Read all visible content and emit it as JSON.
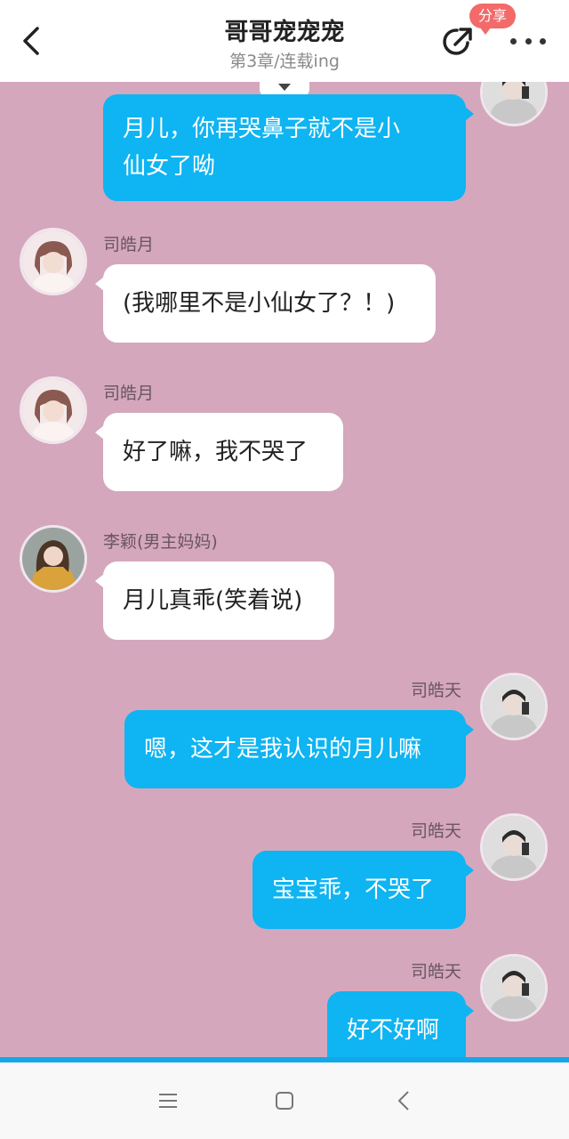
{
  "header": {
    "title": "哥哥宠宠宠",
    "subtitle": "第3章/连载ing",
    "share_badge": "分享"
  },
  "messages": [
    {
      "side": "right",
      "text_lines": [
        "月儿，你再哭鼻子就不是小",
        "仙女了呦"
      ],
      "avatar": "boy-avatar"
    },
    {
      "side": "left",
      "name": "司皓月",
      "text": "(我哪里不是小仙女了？！)",
      "avatar": "girl-avatar"
    },
    {
      "side": "left",
      "name": "司皓月",
      "text": "好了嘛，我不哭了",
      "avatar": "girl-avatar"
    },
    {
      "side": "left",
      "name": "李颖(男主妈妈)",
      "text": "月儿真乖(笑着说)",
      "avatar": "mother-avatar"
    },
    {
      "side": "right",
      "name": "司皓天",
      "text": "嗯，这才是我认识的月儿嘛",
      "avatar": "boy-avatar"
    },
    {
      "side": "right",
      "name": "司皓天",
      "text": "宝宝乖，不哭了",
      "avatar": "boy-avatar"
    },
    {
      "side": "right",
      "name": "司皓天",
      "text": "好不好啊",
      "avatar": "boy-avatar"
    }
  ],
  "colors": {
    "chat_background": "#d4a7bd",
    "blue_bubble": "#0fb4f2",
    "white_bubble": "#ffffff",
    "share_badge": "#f26a6a"
  },
  "system_nav": {
    "icons": [
      "menu-icon",
      "home-icon",
      "back-nav-icon"
    ]
  }
}
